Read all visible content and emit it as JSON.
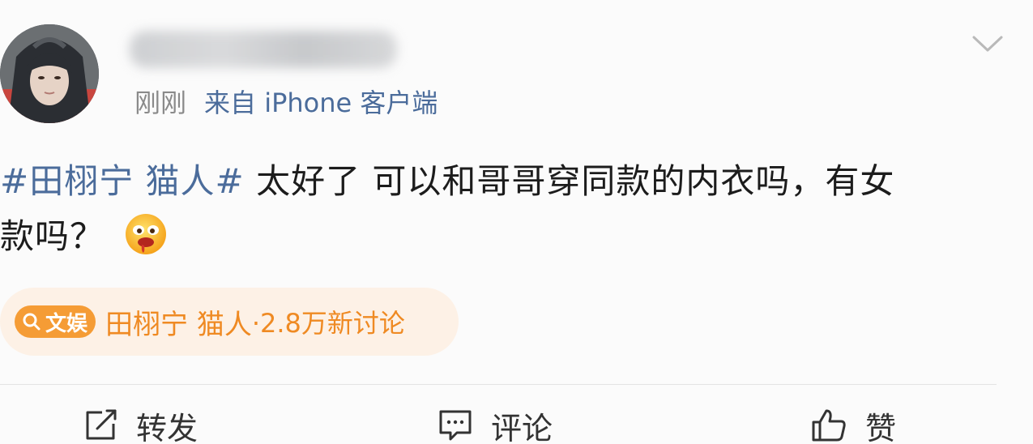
{
  "post": {
    "time": "刚刚",
    "source": "来自 iPhone 客户端",
    "hashtag": "#田栩宁 猫人#",
    "text_line1": " 太好了 可以和哥哥穿同款的内衣吗，有女",
    "text_line2": "款吗？",
    "emoji": "drooling-face-emoji"
  },
  "topic": {
    "badge_label": "文娱",
    "title": "田栩宁 猫人",
    "count": "·2.8万新讨论"
  },
  "actions": {
    "repost_label": "转发",
    "comment_label": "评论",
    "like_label": "赞"
  },
  "colors": {
    "link": "#4b6c9b",
    "topic_accent": "#ef8a23",
    "topic_bg": "#fdf1e6",
    "text": "#1c1c1c",
    "meta": "#8a8a8a"
  },
  "icons": {
    "menu": "chevron-down-icon",
    "repost": "repost-icon",
    "comment": "comment-icon",
    "like": "thumbs-up-icon",
    "search": "search-icon"
  }
}
